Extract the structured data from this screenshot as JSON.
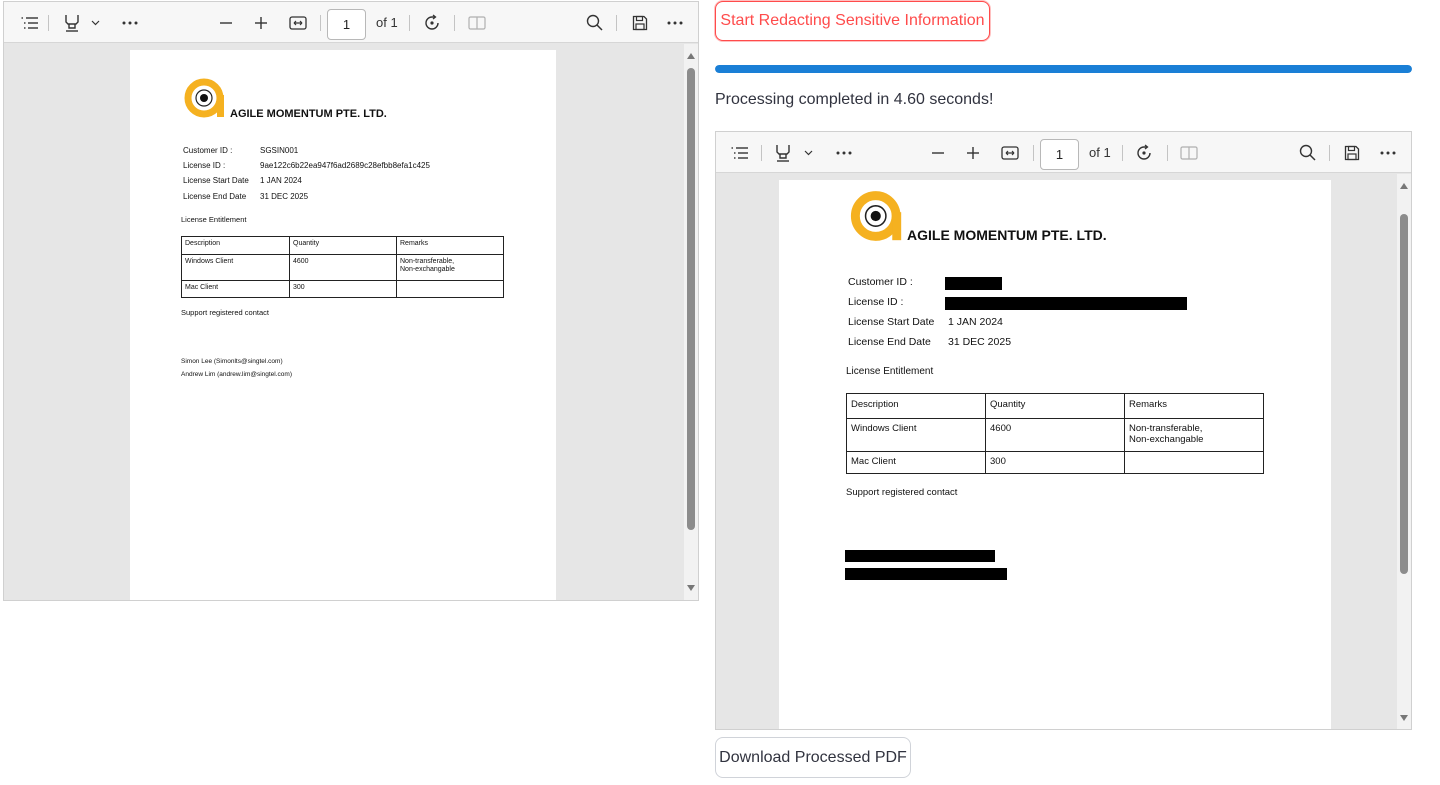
{
  "viewer_toolbar": {
    "page_number": "1",
    "page_of": "of 1"
  },
  "document": {
    "company": "AGILE MOMENTUM PTE. LTD.",
    "fields": [
      {
        "label": "Customer ID :",
        "value": "SGSIN001"
      },
      {
        "label": "License ID :",
        "value": "9ae122c6b22ea947f6ad2689c28efbb8efa1c425"
      },
      {
        "label": "License Start Date",
        "value": "1 JAN 2024"
      },
      {
        "label": "License End Date",
        "value": "31 DEC 2025"
      }
    ],
    "section_title": "License Entitlement",
    "table": {
      "headers": [
        "Description",
        "Quantity",
        "Remarks"
      ],
      "rows": [
        [
          "Windows Client",
          "4600",
          "Non-transferable,\nNon-exchangable"
        ],
        [
          "Mac Client",
          "300",
          ""
        ]
      ]
    },
    "support_title": "Support registered contact",
    "contacts": [
      "Simon Lee (Simonlts@singtel.com)",
      "Andrew Lim (andrew.lim@singtel.com)"
    ]
  },
  "actions": {
    "redact_button": "Start Redacting Sensitive Information",
    "download_button": "Download Processed PDF"
  },
  "progress": {
    "percent": 100
  },
  "status_text": "Processing completed in 4.60 seconds!",
  "colors": {
    "accent_red": "#ff4b4b",
    "progress_blue": "#1a7fd6",
    "logo_orange": "#f5b120"
  }
}
